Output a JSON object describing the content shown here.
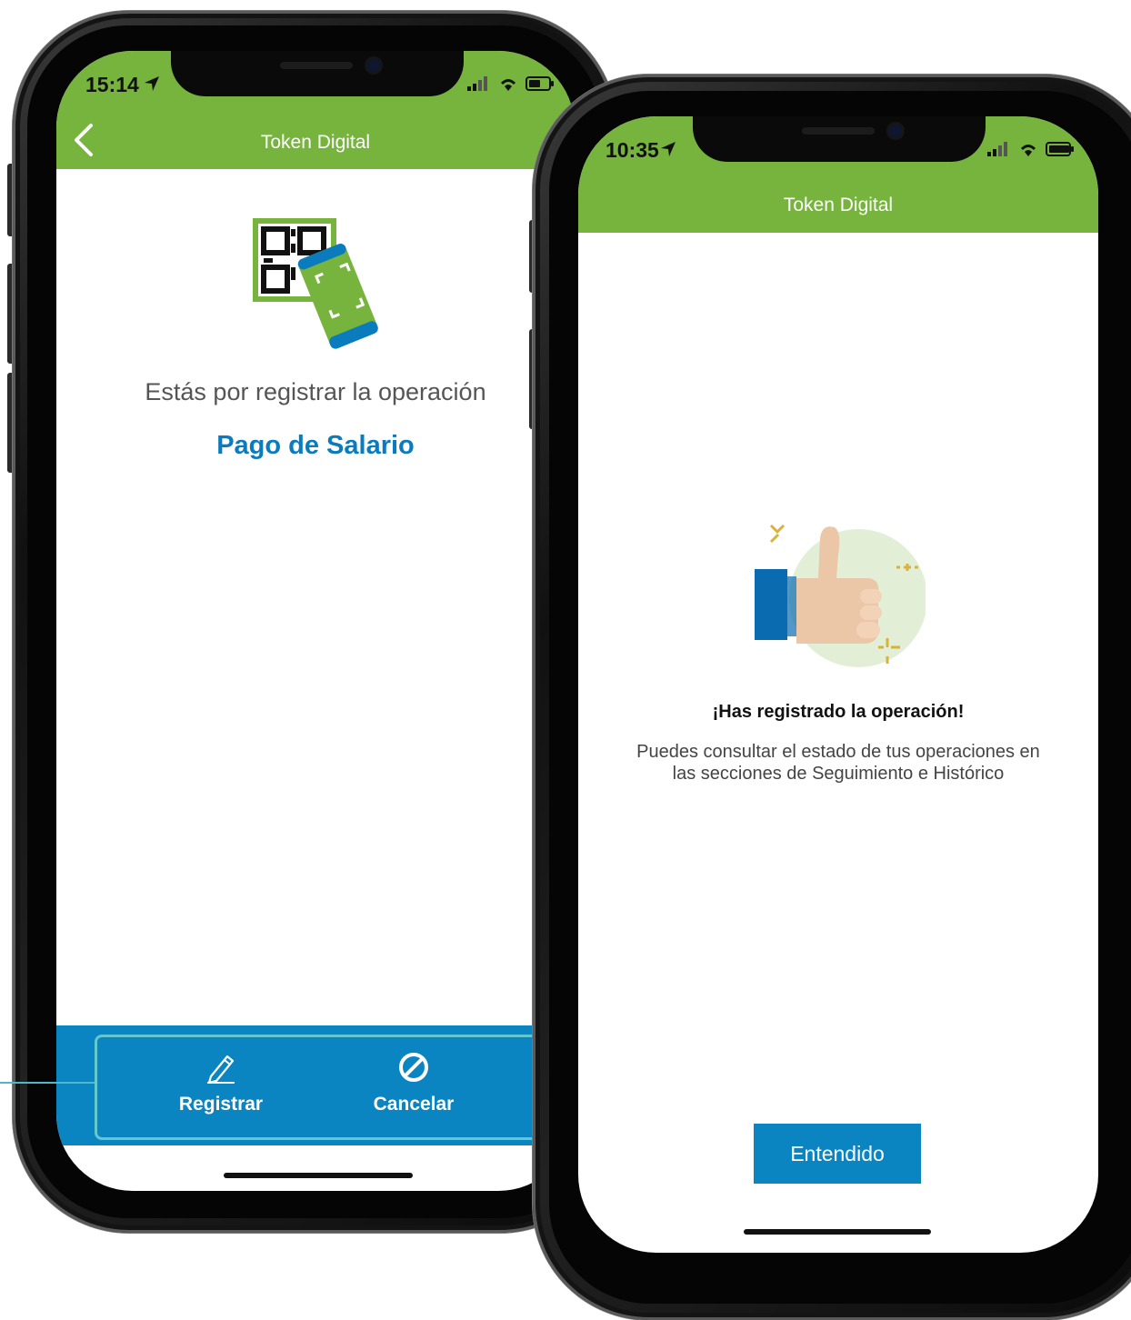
{
  "screen_left": {
    "status_time": "15:14",
    "header_title": "Token Digital",
    "prompt_text": "Estás por registrar la operación",
    "operation_name": "Pago de Salario",
    "actions": [
      {
        "label": "Registrar",
        "icon": "pencil-icon"
      },
      {
        "label": "Cancelar",
        "icon": "prohibited-icon"
      }
    ]
  },
  "screen_right": {
    "status_time": "10:35",
    "header_title": "Token Digital",
    "success_title": "¡Has registrado la operación!",
    "success_line_1": "Puedes consultar el estado de tus operaciones en",
    "success_line_2": "las secciones de Seguimiento e Histórico",
    "confirm_label": "Entendido"
  },
  "colors": {
    "header_green": "#77b43e",
    "action_blue": "#0a85c2",
    "operation_blue": "#0a7bbd",
    "highlight_teal": "#63c8d0"
  }
}
